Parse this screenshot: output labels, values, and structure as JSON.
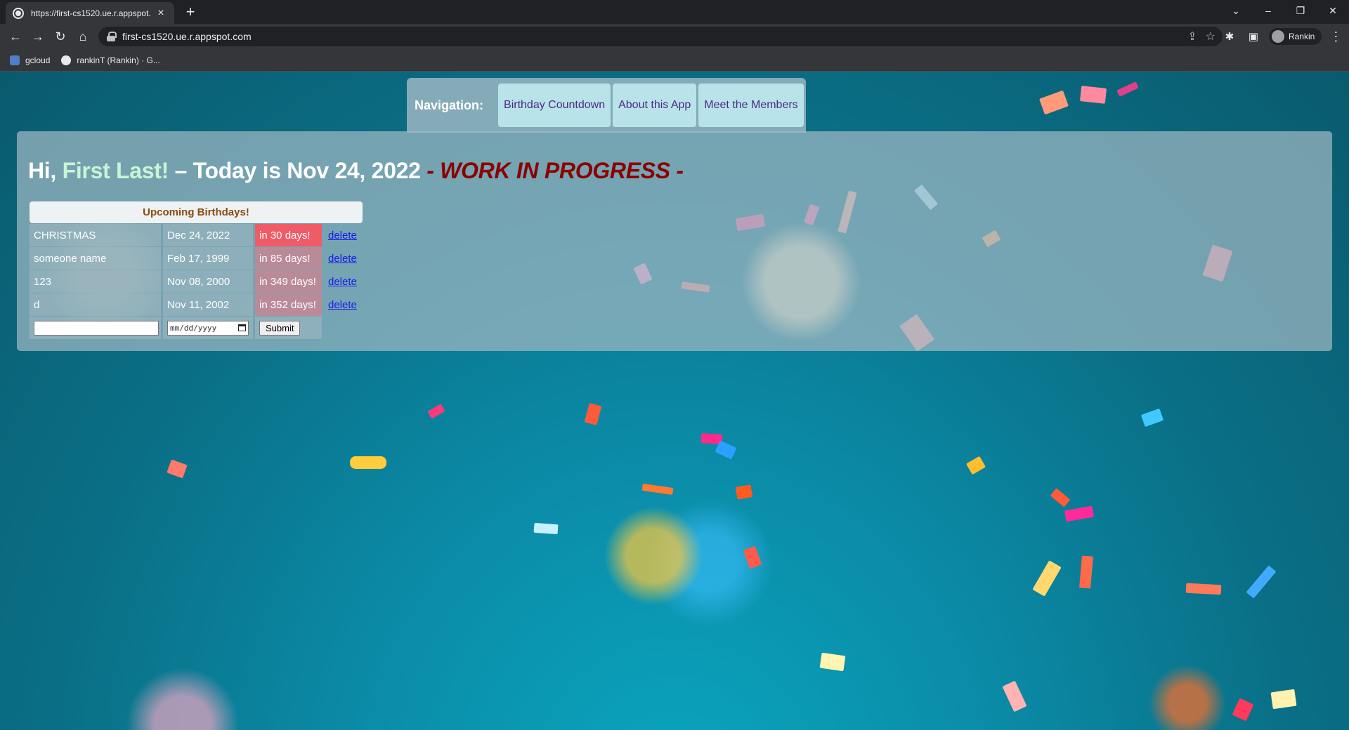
{
  "browser": {
    "tab_title": "https://first-cs1520.ue.r.appspot.",
    "url": "first-cs1520.ue.r.appspot.com",
    "profile_name": "Rankin",
    "bookmarks": [
      {
        "label": "gcloud",
        "icon": "gcloud-icon"
      },
      {
        "label": "rankinT (Rankin) · G...",
        "icon": "github-icon"
      }
    ]
  },
  "nav": {
    "label": "Navigation:",
    "items": [
      {
        "label": "Birthday Countdown"
      },
      {
        "label": "About this App"
      },
      {
        "label": "Meet the Members"
      }
    ]
  },
  "header": {
    "greeting": "Hi,",
    "user_name": "First Last!",
    "today_text": "– Today is Nov 24, 2022",
    "wip": "- WORK IN PROGRESS -"
  },
  "birthdays": {
    "title": "Upcoming Birthdays!",
    "rows": [
      {
        "name": "CHRISTMAS",
        "date": "Dec 24, 2022",
        "countdown": "in 30 days!",
        "action": "delete"
      },
      {
        "name": "someone name",
        "date": "Feb 17, 1999",
        "countdown": "in 85 days!",
        "action": "delete"
      },
      {
        "name": "123",
        "date": "Nov 08, 2000",
        "countdown": "in 349 days!",
        "action": "delete"
      },
      {
        "name": "d",
        "date": "Nov 11, 2002",
        "countdown": "in 352 days!",
        "action": "delete"
      }
    ],
    "form": {
      "name_value": "",
      "date_placeholder": "mm/dd/yyyy",
      "submit_label": "Submit"
    }
  },
  "colors": {
    "accent_name": "#c9f5d6",
    "wip": "#8b0000",
    "nav_button": "#b8e3e8",
    "countdown_soon": "#ef5b67"
  }
}
